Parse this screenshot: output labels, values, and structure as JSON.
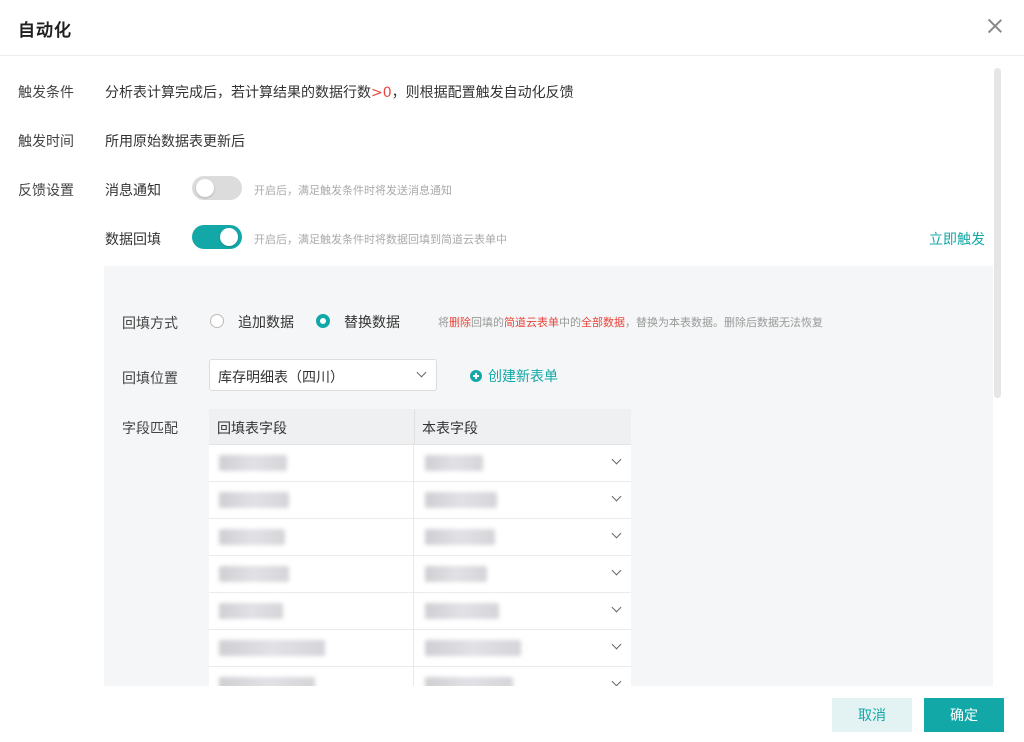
{
  "dialog": {
    "title": "自动化"
  },
  "trigger_condition": {
    "label": "触发条件",
    "text_before": "分析表计算完成后，若计算结果的数据行数",
    "threshold": ">0",
    "text_after": "，则根据配置触发自动化反馈"
  },
  "trigger_time": {
    "label": "触发时间",
    "value": "所用原始数据表更新后"
  },
  "feedback": {
    "label": "反馈设置",
    "message_notify": {
      "label": "消息通知",
      "enabled": false,
      "hint": "开启后，满足触发条件时将发送消息通知"
    },
    "data_fill": {
      "label": "数据回填",
      "enabled": true,
      "hint": "开启后，满足触发条件时将数据回填到简道云表单中",
      "trigger_now": "立即触发"
    }
  },
  "panel": {
    "fill_mode": {
      "label": "回填方式",
      "options": [
        {
          "label": "追加数据",
          "checked": false
        },
        {
          "label": "替换数据",
          "checked": true
        }
      ],
      "notice": {
        "p1": "将",
        "p2": "删除",
        "p3": "回填的",
        "p4": "简道云表单",
        "p5": "中的",
        "p6": "全部数据",
        "p7": "，替换为本表数据。删除后数据无法恢复"
      }
    },
    "fill_location": {
      "label": "回填位置",
      "selected": "库存明细表（四川）",
      "create_new": "创建新表单"
    },
    "field_match": {
      "label": "字段匹配",
      "columns": [
        "回填表字段",
        "本表字段"
      ],
      "row_count": 7
    }
  },
  "footer": {
    "cancel": "取消",
    "confirm": "确定"
  },
  "colors": {
    "accent": "#13a8a8",
    "danger": "#e8453c"
  }
}
